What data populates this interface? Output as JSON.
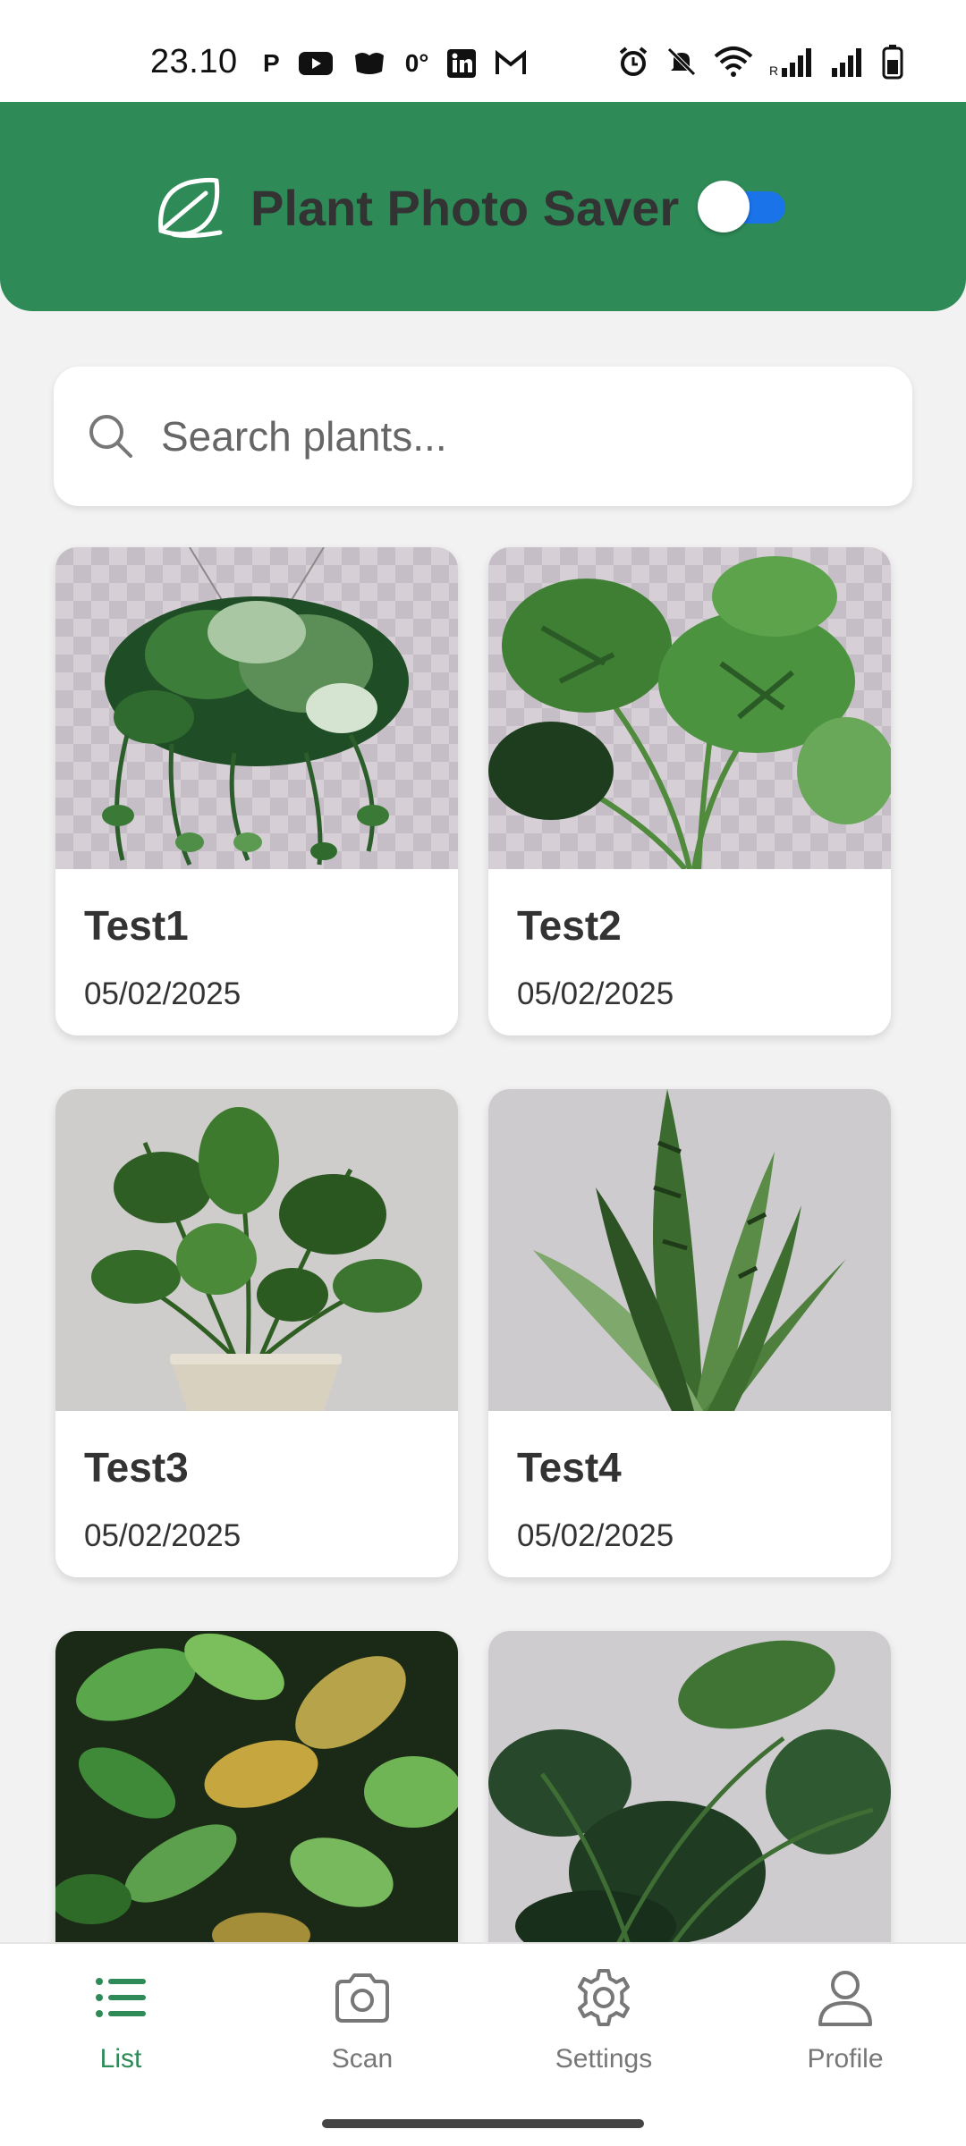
{
  "status_bar": {
    "time": "23.10",
    "left_icons": [
      "p-icon",
      "youtube-icon",
      "app-icon",
      "temperature-icon",
      "linkedin-icon",
      "gmail-icon"
    ],
    "temperature": "0°",
    "right_icons": [
      "alarm-icon",
      "mute-icon",
      "wifi-icon",
      "signal-icon",
      "signal-icon",
      "battery-icon"
    ]
  },
  "header": {
    "title": "Plant Photo Saver",
    "toggle_on": true
  },
  "search": {
    "placeholder": "Search plants..."
  },
  "plants": [
    {
      "name": "Test1",
      "date": "05/02/2025",
      "image": "pothos"
    },
    {
      "name": "Test2",
      "date": "05/02/2025",
      "image": "monstera"
    },
    {
      "name": "Test3",
      "date": "05/02/2025",
      "image": "zz-plant"
    },
    {
      "name": "Test4",
      "date": "05/02/2025",
      "image": "snake-plant"
    },
    {
      "name": "",
      "date": "",
      "image": "croton"
    },
    {
      "name": "",
      "date": "",
      "image": "monstera-dark"
    }
  ],
  "nav": {
    "items": [
      {
        "label": "List",
        "icon": "list-icon",
        "active": true
      },
      {
        "label": "Scan",
        "icon": "camera-icon",
        "active": false
      },
      {
        "label": "Settings",
        "icon": "gear-icon",
        "active": false
      },
      {
        "label": "Profile",
        "icon": "person-icon",
        "active": false
      }
    ]
  },
  "colors": {
    "header": "#2e8b57",
    "accent": "#2e8b57",
    "toggle": "#1a73e8"
  }
}
